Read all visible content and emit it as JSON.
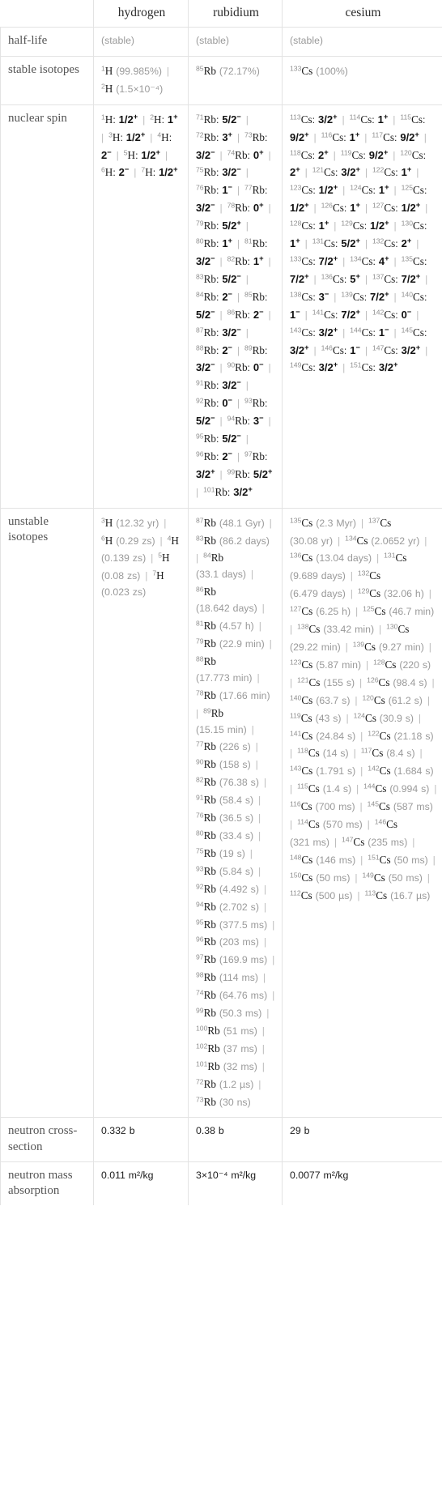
{
  "table": {
    "columns": [
      "",
      "hydrogen",
      "rubidium",
      "cesium"
    ],
    "row_labels": {
      "half_life": "half-life",
      "stable_isotopes": "stable isotopes",
      "nuclear_spin": "nuclear spin",
      "unstable_isotopes": "unstable isotopes",
      "neutron_cross_section": "neutron cross-section",
      "neutron_mass_absorption": "neutron mass absorption"
    },
    "half_life": {
      "hydrogen": "(stable)",
      "rubidium": "(stable)",
      "cesium": "(stable)"
    },
    "stable_isotopes": {
      "hydrogen": [
        {
          "mass": "1",
          "sym": "H",
          "note": "(99.985%)"
        },
        {
          "mass": "2",
          "sym": "H",
          "note": "(1.5×10⁻⁴)"
        }
      ],
      "rubidium": [
        {
          "mass": "85",
          "sym": "Rb",
          "note": "(72.17%)"
        }
      ],
      "cesium": [
        {
          "mass": "133",
          "sym": "Cs",
          "note": "(100%)"
        }
      ]
    },
    "nuclear_spin": {
      "hydrogen": [
        {
          "mass": "1",
          "sym": "H",
          "spin": "1/2",
          "sign": "+"
        },
        {
          "mass": "2",
          "sym": "H",
          "spin": "1",
          "sign": "+"
        },
        {
          "mass": "3",
          "sym": "H",
          "spin": "1/2",
          "sign": "+"
        },
        {
          "mass": "4",
          "sym": "H",
          "spin": "2",
          "sign": "−"
        },
        {
          "mass": "5",
          "sym": "H",
          "spin": "1/2",
          "sign": "+"
        },
        {
          "mass": "6",
          "sym": "H",
          "spin": "2",
          "sign": "−"
        },
        {
          "mass": "7",
          "sym": "H",
          "spin": "1/2",
          "sign": "+"
        }
      ],
      "rubidium": [
        {
          "mass": "71",
          "sym": "Rb",
          "spin": "5/2",
          "sign": "−"
        },
        {
          "mass": "72",
          "sym": "Rb",
          "spin": "3",
          "sign": "+"
        },
        {
          "mass": "73",
          "sym": "Rb",
          "spin": "3/2",
          "sign": "−"
        },
        {
          "mass": "74",
          "sym": "Rb",
          "spin": "0",
          "sign": "+"
        },
        {
          "mass": "75",
          "sym": "Rb",
          "spin": "3/2",
          "sign": "−"
        },
        {
          "mass": "76",
          "sym": "Rb",
          "spin": "1",
          "sign": "−"
        },
        {
          "mass": "77",
          "sym": "Rb",
          "spin": "3/2",
          "sign": "−"
        },
        {
          "mass": "78",
          "sym": "Rb",
          "spin": "0",
          "sign": "+"
        },
        {
          "mass": "79",
          "sym": "Rb",
          "spin": "5/2",
          "sign": "+"
        },
        {
          "mass": "80",
          "sym": "Rb",
          "spin": "1",
          "sign": "+"
        },
        {
          "mass": "81",
          "sym": "Rb",
          "spin": "3/2",
          "sign": "−"
        },
        {
          "mass": "82",
          "sym": "Rb",
          "spin": "1",
          "sign": "+"
        },
        {
          "mass": "83",
          "sym": "Rb",
          "spin": "5/2",
          "sign": "−"
        },
        {
          "mass": "84",
          "sym": "Rb",
          "spin": "2",
          "sign": "−"
        },
        {
          "mass": "85",
          "sym": "Rb",
          "spin": "5/2",
          "sign": "−"
        },
        {
          "mass": "86",
          "sym": "Rb",
          "spin": "2",
          "sign": "−"
        },
        {
          "mass": "87",
          "sym": "Rb",
          "spin": "3/2",
          "sign": "−"
        },
        {
          "mass": "88",
          "sym": "Rb",
          "spin": "2",
          "sign": "−"
        },
        {
          "mass": "89",
          "sym": "Rb",
          "spin": "3/2",
          "sign": "−"
        },
        {
          "mass": "90",
          "sym": "Rb",
          "spin": "0",
          "sign": "−"
        },
        {
          "mass": "91",
          "sym": "Rb",
          "spin": "3/2",
          "sign": "−"
        },
        {
          "mass": "92",
          "sym": "Rb",
          "spin": "0",
          "sign": "−"
        },
        {
          "mass": "93",
          "sym": "Rb",
          "spin": "5/2",
          "sign": "−"
        },
        {
          "mass": "94",
          "sym": "Rb",
          "spin": "3",
          "sign": "−"
        },
        {
          "mass": "95",
          "sym": "Rb",
          "spin": "5/2",
          "sign": "−"
        },
        {
          "mass": "96",
          "sym": "Rb",
          "spin": "2",
          "sign": "−"
        },
        {
          "mass": "97",
          "sym": "Rb",
          "spin": "3/2",
          "sign": "+"
        },
        {
          "mass": "99",
          "sym": "Rb",
          "spin": "5/2",
          "sign": "+"
        },
        {
          "mass": "101",
          "sym": "Rb",
          "spin": "3/2",
          "sign": "+"
        }
      ],
      "cesium": [
        {
          "mass": "113",
          "sym": "Cs",
          "spin": "3/2",
          "sign": "+"
        },
        {
          "mass": "114",
          "sym": "Cs",
          "spin": "1",
          "sign": "+"
        },
        {
          "mass": "115",
          "sym": "Cs",
          "spin": "9/2",
          "sign": "+"
        },
        {
          "mass": "116",
          "sym": "Cs",
          "spin": "1",
          "sign": "+"
        },
        {
          "mass": "117",
          "sym": "Cs",
          "spin": "9/2",
          "sign": "+"
        },
        {
          "mass": "118",
          "sym": "Cs",
          "spin": "2",
          "sign": "+"
        },
        {
          "mass": "119",
          "sym": "Cs",
          "spin": "9/2",
          "sign": "+"
        },
        {
          "mass": "120",
          "sym": "Cs",
          "spin": "2",
          "sign": "+"
        },
        {
          "mass": "121",
          "sym": "Cs",
          "spin": "3/2",
          "sign": "+"
        },
        {
          "mass": "122",
          "sym": "Cs",
          "spin": "1",
          "sign": "+"
        },
        {
          "mass": "123",
          "sym": "Cs",
          "spin": "1/2",
          "sign": "+"
        },
        {
          "mass": "124",
          "sym": "Cs",
          "spin": "1",
          "sign": "+"
        },
        {
          "mass": "125",
          "sym": "Cs",
          "spin": "1/2",
          "sign": "+"
        },
        {
          "mass": "126",
          "sym": "Cs",
          "spin": "1",
          "sign": "+"
        },
        {
          "mass": "127",
          "sym": "Cs",
          "spin": "1/2",
          "sign": "+"
        },
        {
          "mass": "128",
          "sym": "Cs",
          "spin": "1",
          "sign": "+"
        },
        {
          "mass": "129",
          "sym": "Cs",
          "spin": "1/2",
          "sign": "+"
        },
        {
          "mass": "130",
          "sym": "Cs",
          "spin": "1",
          "sign": "+"
        },
        {
          "mass": "131",
          "sym": "Cs",
          "spin": "5/2",
          "sign": "+"
        },
        {
          "mass": "132",
          "sym": "Cs",
          "spin": "2",
          "sign": "+"
        },
        {
          "mass": "133",
          "sym": "Cs",
          "spin": "7/2",
          "sign": "+"
        },
        {
          "mass": "134",
          "sym": "Cs",
          "spin": "4",
          "sign": "+"
        },
        {
          "mass": "135",
          "sym": "Cs",
          "spin": "7/2",
          "sign": "+"
        },
        {
          "mass": "136",
          "sym": "Cs",
          "spin": "5",
          "sign": "+"
        },
        {
          "mass": "137",
          "sym": "Cs",
          "spin": "7/2",
          "sign": "+"
        },
        {
          "mass": "138",
          "sym": "Cs",
          "spin": "3",
          "sign": "−"
        },
        {
          "mass": "139",
          "sym": "Cs",
          "spin": "7/2",
          "sign": "+"
        },
        {
          "mass": "140",
          "sym": "Cs",
          "spin": "1",
          "sign": "−"
        },
        {
          "mass": "141",
          "sym": "Cs",
          "spin": "7/2",
          "sign": "+"
        },
        {
          "mass": "142",
          "sym": "Cs",
          "spin": "0",
          "sign": "−"
        },
        {
          "mass": "143",
          "sym": "Cs",
          "spin": "3/2",
          "sign": "+"
        },
        {
          "mass": "144",
          "sym": "Cs",
          "spin": "1",
          "sign": "−"
        },
        {
          "mass": "145",
          "sym": "Cs",
          "spin": "3/2",
          "sign": "+"
        },
        {
          "mass": "146",
          "sym": "Cs",
          "spin": "1",
          "sign": "−"
        },
        {
          "mass": "147",
          "sym": "Cs",
          "spin": "3/2",
          "sign": "+"
        },
        {
          "mass": "149",
          "sym": "Cs",
          "spin": "3/2",
          "sign": "+"
        },
        {
          "mass": "151",
          "sym": "Cs",
          "spin": "3/2",
          "sign": "+"
        }
      ]
    },
    "unstable_isotopes": {
      "hydrogen": [
        {
          "mass": "3",
          "sym": "H",
          "note": "(12.32 yr)"
        },
        {
          "mass": "6",
          "sym": "H",
          "note": "(0.29 zs)"
        },
        {
          "mass": "4",
          "sym": "H",
          "note": "(0.139 zs)"
        },
        {
          "mass": "5",
          "sym": "H",
          "note": "(0.08 zs)"
        },
        {
          "mass": "7",
          "sym": "H",
          "note": "(0.023 zs)"
        }
      ],
      "rubidium": [
        {
          "mass": "87",
          "sym": "Rb",
          "note": "(48.1 Gyr)"
        },
        {
          "mass": "83",
          "sym": "Rb",
          "note": "(86.2 days)"
        },
        {
          "mass": "84",
          "sym": "Rb",
          "note": "(33.1 days)"
        },
        {
          "mass": "86",
          "sym": "Rb",
          "note": "(18.642 days)"
        },
        {
          "mass": "81",
          "sym": "Rb",
          "note": "(4.57 h)"
        },
        {
          "mass": "79",
          "sym": "Rb",
          "note": "(22.9 min)"
        },
        {
          "mass": "88",
          "sym": "Rb",
          "note": "(17.773 min)"
        },
        {
          "mass": "78",
          "sym": "Rb",
          "note": "(17.66 min)"
        },
        {
          "mass": "89",
          "sym": "Rb",
          "note": "(15.15 min)"
        },
        {
          "mass": "77",
          "sym": "Rb",
          "note": "(226 s)"
        },
        {
          "mass": "90",
          "sym": "Rb",
          "note": "(158 s)"
        },
        {
          "mass": "82",
          "sym": "Rb",
          "note": "(76.38 s)"
        },
        {
          "mass": "91",
          "sym": "Rb",
          "note": "(58.4 s)"
        },
        {
          "mass": "76",
          "sym": "Rb",
          "note": "(36.5 s)"
        },
        {
          "mass": "80",
          "sym": "Rb",
          "note": "(33.4 s)"
        },
        {
          "mass": "75",
          "sym": "Rb",
          "note": "(19 s)"
        },
        {
          "mass": "93",
          "sym": "Rb",
          "note": "(5.84 s)"
        },
        {
          "mass": "92",
          "sym": "Rb",
          "note": "(4.492 s)"
        },
        {
          "mass": "94",
          "sym": "Rb",
          "note": "(2.702 s)"
        },
        {
          "mass": "95",
          "sym": "Rb",
          "note": "(377.5 ms)"
        },
        {
          "mass": "96",
          "sym": "Rb",
          "note": "(203 ms)"
        },
        {
          "mass": "97",
          "sym": "Rb",
          "note": "(169.9 ms)"
        },
        {
          "mass": "98",
          "sym": "Rb",
          "note": "(114 ms)"
        },
        {
          "mass": "74",
          "sym": "Rb",
          "note": "(64.76 ms)"
        },
        {
          "mass": "99",
          "sym": "Rb",
          "note": "(50.3 ms)"
        },
        {
          "mass": "100",
          "sym": "Rb",
          "note": "(51 ms)"
        },
        {
          "mass": "102",
          "sym": "Rb",
          "note": "(37 ms)"
        },
        {
          "mass": "101",
          "sym": "Rb",
          "note": "(32 ms)"
        },
        {
          "mass": "72",
          "sym": "Rb",
          "note": "(1.2 µs)"
        },
        {
          "mass": "73",
          "sym": "Rb",
          "note": "(30 ns)"
        }
      ],
      "cesium": [
        {
          "mass": "135",
          "sym": "Cs",
          "note": "(2.3 Myr)"
        },
        {
          "mass": "137",
          "sym": "Cs",
          "note": "(30.08 yr)"
        },
        {
          "mass": "134",
          "sym": "Cs",
          "note": "(2.0652 yr)"
        },
        {
          "mass": "136",
          "sym": "Cs",
          "note": "(13.04 days)"
        },
        {
          "mass": "131",
          "sym": "Cs",
          "note": "(9.689 days)"
        },
        {
          "mass": "132",
          "sym": "Cs",
          "note": "(6.479 days)"
        },
        {
          "mass": "129",
          "sym": "Cs",
          "note": "(32.06 h)"
        },
        {
          "mass": "127",
          "sym": "Cs",
          "note": "(6.25 h)"
        },
        {
          "mass": "125",
          "sym": "Cs",
          "note": "(46.7 min)"
        },
        {
          "mass": "138",
          "sym": "Cs",
          "note": "(33.42 min)"
        },
        {
          "mass": "130",
          "sym": "Cs",
          "note": "(29.22 min)"
        },
        {
          "mass": "139",
          "sym": "Cs",
          "note": "(9.27 min)"
        },
        {
          "mass": "123",
          "sym": "Cs",
          "note": "(5.87 min)"
        },
        {
          "mass": "128",
          "sym": "Cs",
          "note": "(220 s)"
        },
        {
          "mass": "121",
          "sym": "Cs",
          "note": "(155 s)"
        },
        {
          "mass": "126",
          "sym": "Cs",
          "note": "(98.4 s)"
        },
        {
          "mass": "140",
          "sym": "Cs",
          "note": "(63.7 s)"
        },
        {
          "mass": "120",
          "sym": "Cs",
          "note": "(61.2 s)"
        },
        {
          "mass": "119",
          "sym": "Cs",
          "note": "(43 s)"
        },
        {
          "mass": "124",
          "sym": "Cs",
          "note": "(30.9 s)"
        },
        {
          "mass": "141",
          "sym": "Cs",
          "note": "(24.84 s)"
        },
        {
          "mass": "122",
          "sym": "Cs",
          "note": "(21.18 s)"
        },
        {
          "mass": "118",
          "sym": "Cs",
          "note": "(14 s)"
        },
        {
          "mass": "117",
          "sym": "Cs",
          "note": "(8.4 s)"
        },
        {
          "mass": "143",
          "sym": "Cs",
          "note": "(1.791 s)"
        },
        {
          "mass": "142",
          "sym": "Cs",
          "note": "(1.684 s)"
        },
        {
          "mass": "115",
          "sym": "Cs",
          "note": "(1.4 s)"
        },
        {
          "mass": "144",
          "sym": "Cs",
          "note": "(0.994 s)"
        },
        {
          "mass": "116",
          "sym": "Cs",
          "note": "(700 ms)"
        },
        {
          "mass": "145",
          "sym": "Cs",
          "note": "(587 ms)"
        },
        {
          "mass": "114",
          "sym": "Cs",
          "note": "(570 ms)"
        },
        {
          "mass": "146",
          "sym": "Cs",
          "note": "(321 ms)"
        },
        {
          "mass": "147",
          "sym": "Cs",
          "note": "(235 ms)"
        },
        {
          "mass": "148",
          "sym": "Cs",
          "note": "(146 ms)"
        },
        {
          "mass": "151",
          "sym": "Cs",
          "note": "(50 ms)"
        },
        {
          "mass": "150",
          "sym": "Cs",
          "note": "(50 ms)"
        },
        {
          "mass": "149",
          "sym": "Cs",
          "note": "(50 ms)"
        },
        {
          "mass": "112",
          "sym": "Cs",
          "note": "(500 µs)"
        },
        {
          "mass": "113",
          "sym": "Cs",
          "note": "(16.7 µs)"
        }
      ]
    },
    "neutron_cross_section": {
      "hydrogen": "0.332 b",
      "rubidium": "0.38 b",
      "cesium": "29 b"
    },
    "neutron_mass_absorption": {
      "hydrogen": {
        "mantissa": "0.011",
        "unit": "m²/kg"
      },
      "rubidium": {
        "mantissa": "3×10⁻⁴",
        "unit": "m²/kg"
      },
      "cesium": {
        "mantissa": "0.0077",
        "unit": "m²/kg"
      }
    },
    "separator": "|"
  }
}
